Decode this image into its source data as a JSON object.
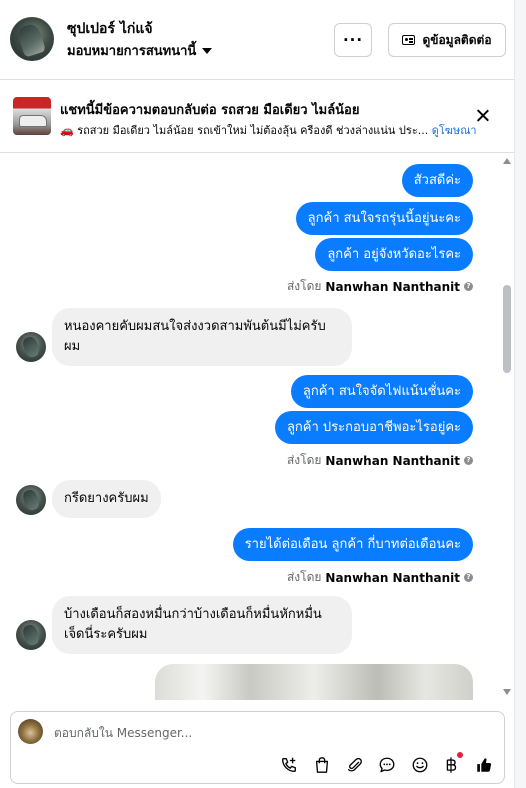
{
  "header": {
    "name": "ซุปเปอร์ ไก่แจ้",
    "assign": "มอบหมายการสนทนานี้",
    "more_label": "···",
    "contact_label": "ดูข้อมูลติดต่อ"
  },
  "banner": {
    "title": "แชทนี้มีข้อความตอบกลับต่อ รถสวย มือเดียว ไมล์น้อย",
    "text": "🚗 รถสวย มือเดียว ไมล์น้อย รถเข้าใหม่ ไม่ต้องลุ้น ครีองดี ช่วงล่างแน่น ประ...",
    "link": "ดูโฆษณา"
  },
  "messages": {
    "out1": "สัวสดีค่ะ",
    "out2": "ลูกค้า สนใจรถรุ่นนี้อยู่นะคะ",
    "out3": "ลูกค้า อยู่จังหวัดอะไรคะ",
    "sent1_prefix": "ส่งโดย",
    "sent1_name": "Nanwhan Nanthanit",
    "in1_line1": "หนองคายคับผมสนใจส่งงวดสามพันต้นมีไม่ครับ",
    "in1_line2": "ผม",
    "out4": "ลูกค้า สนใจจัดไฟแน้นชั่นคะ",
    "out5": "ลูกค้า ประกอบอาชีพอะไรอยู่คะ",
    "sent2_prefix": "ส่งโดย",
    "sent2_name": "Nanwhan Nanthanit",
    "in2": "กรีดยางครับผม",
    "out6": "รายได้ต่อเดือน  ลูกค้า กี่บาทต่อเดือนคะ",
    "sent3_prefix": "ส่งโดย",
    "sent3_name": "Nanwhan Nanthanit",
    "in3_line1": "บ้างเดือนก็สองหมื่นกว่าบ้างเดือนก็หมื่นหักหมื่น",
    "in3_line2": "เจ็ดนี่ระครับผม",
    "help_glyph": "?"
  },
  "composer": {
    "placeholder": "ตอบกลับใน Messenger..."
  },
  "icons": {
    "header_more": "more-dots-icon",
    "contact": "id-card-icon",
    "close": "close-icon",
    "tools": [
      "add-call-icon",
      "shopping-bag-icon",
      "paperclip-icon",
      "chat-bubble-icon",
      "emoji-icon",
      "baht-icon",
      "thumbs-up-icon"
    ]
  },
  "colors": {
    "outgoing_bubble": "#0a7cff",
    "incoming_bubble": "#f0f0f0",
    "link": "#1a6ed8",
    "notification_dot": "#e41e3f"
  }
}
